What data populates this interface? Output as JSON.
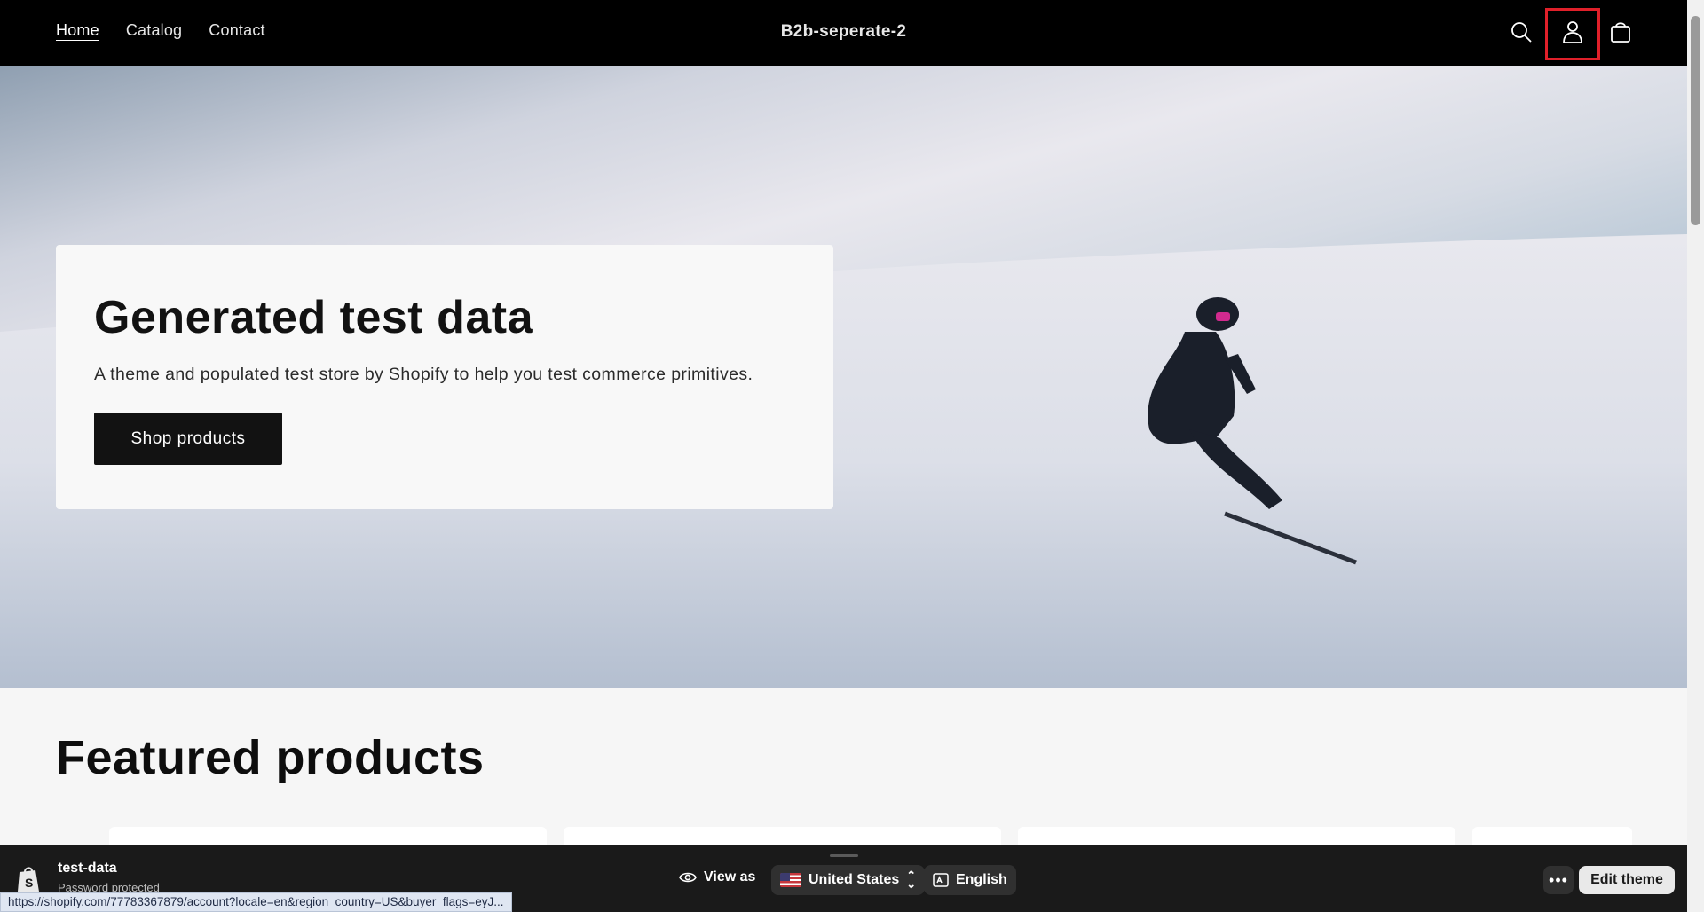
{
  "header": {
    "nav": [
      {
        "label": "Home",
        "active": true
      },
      {
        "label": "Catalog",
        "active": false
      },
      {
        "label": "Contact",
        "active": false
      }
    ],
    "store_name": "B2b-seperate-2",
    "icons": [
      "search-icon",
      "account-icon",
      "cart-icon"
    ]
  },
  "hero": {
    "title": "Generated test data",
    "subtitle": "A theme and populated test store by Shopify to help you test commerce primitives.",
    "button_label": "Shop products"
  },
  "featured": {
    "title": "Featured products"
  },
  "preview_bar": {
    "shop_name": "test-data",
    "shop_status": "Password protected",
    "view_as_label": "View as",
    "country": "United States",
    "language": "English",
    "more_label": "•••",
    "edit_label": "Edit theme"
  },
  "status_url": "https://shopify.com/77783367879/account?locale=en&region_country=US&buyer_flags=eyJ...",
  "colors": {
    "header_bg": "#000000",
    "button_bg": "#121212",
    "highlight": "#e0202a",
    "preview_bar_bg": "#1a1a1a"
  }
}
